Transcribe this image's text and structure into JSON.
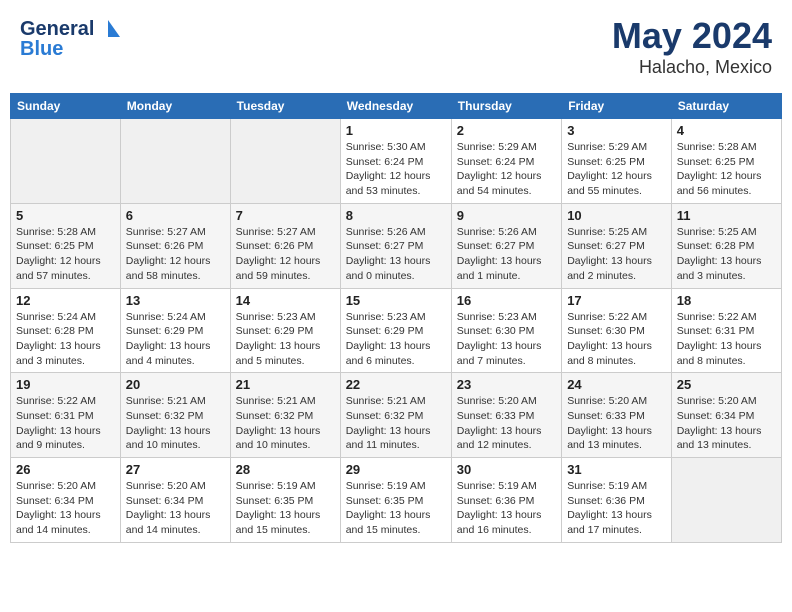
{
  "header": {
    "logo_line1": "General",
    "logo_line2": "Blue",
    "title": "May 2024",
    "location": "Halacho, Mexico"
  },
  "weekdays": [
    "Sunday",
    "Monday",
    "Tuesday",
    "Wednesday",
    "Thursday",
    "Friday",
    "Saturday"
  ],
  "weeks": [
    [
      {
        "day": "",
        "info": ""
      },
      {
        "day": "",
        "info": ""
      },
      {
        "day": "",
        "info": ""
      },
      {
        "day": "1",
        "info": "Sunrise: 5:30 AM\nSunset: 6:24 PM\nDaylight: 12 hours\nand 53 minutes."
      },
      {
        "day": "2",
        "info": "Sunrise: 5:29 AM\nSunset: 6:24 PM\nDaylight: 12 hours\nand 54 minutes."
      },
      {
        "day": "3",
        "info": "Sunrise: 5:29 AM\nSunset: 6:25 PM\nDaylight: 12 hours\nand 55 minutes."
      },
      {
        "day": "4",
        "info": "Sunrise: 5:28 AM\nSunset: 6:25 PM\nDaylight: 12 hours\nand 56 minutes."
      }
    ],
    [
      {
        "day": "5",
        "info": "Sunrise: 5:28 AM\nSunset: 6:25 PM\nDaylight: 12 hours\nand 57 minutes."
      },
      {
        "day": "6",
        "info": "Sunrise: 5:27 AM\nSunset: 6:26 PM\nDaylight: 12 hours\nand 58 minutes."
      },
      {
        "day": "7",
        "info": "Sunrise: 5:27 AM\nSunset: 6:26 PM\nDaylight: 12 hours\nand 59 minutes."
      },
      {
        "day": "8",
        "info": "Sunrise: 5:26 AM\nSunset: 6:27 PM\nDaylight: 13 hours\nand 0 minutes."
      },
      {
        "day": "9",
        "info": "Sunrise: 5:26 AM\nSunset: 6:27 PM\nDaylight: 13 hours\nand 1 minute."
      },
      {
        "day": "10",
        "info": "Sunrise: 5:25 AM\nSunset: 6:27 PM\nDaylight: 13 hours\nand 2 minutes."
      },
      {
        "day": "11",
        "info": "Sunrise: 5:25 AM\nSunset: 6:28 PM\nDaylight: 13 hours\nand 3 minutes."
      }
    ],
    [
      {
        "day": "12",
        "info": "Sunrise: 5:24 AM\nSunset: 6:28 PM\nDaylight: 13 hours\nand 3 minutes."
      },
      {
        "day": "13",
        "info": "Sunrise: 5:24 AM\nSunset: 6:29 PM\nDaylight: 13 hours\nand 4 minutes."
      },
      {
        "day": "14",
        "info": "Sunrise: 5:23 AM\nSunset: 6:29 PM\nDaylight: 13 hours\nand 5 minutes."
      },
      {
        "day": "15",
        "info": "Sunrise: 5:23 AM\nSunset: 6:29 PM\nDaylight: 13 hours\nand 6 minutes."
      },
      {
        "day": "16",
        "info": "Sunrise: 5:23 AM\nSunset: 6:30 PM\nDaylight: 13 hours\nand 7 minutes."
      },
      {
        "day": "17",
        "info": "Sunrise: 5:22 AM\nSunset: 6:30 PM\nDaylight: 13 hours\nand 8 minutes."
      },
      {
        "day": "18",
        "info": "Sunrise: 5:22 AM\nSunset: 6:31 PM\nDaylight: 13 hours\nand 8 minutes."
      }
    ],
    [
      {
        "day": "19",
        "info": "Sunrise: 5:22 AM\nSunset: 6:31 PM\nDaylight: 13 hours\nand 9 minutes."
      },
      {
        "day": "20",
        "info": "Sunrise: 5:21 AM\nSunset: 6:32 PM\nDaylight: 13 hours\nand 10 minutes."
      },
      {
        "day": "21",
        "info": "Sunrise: 5:21 AM\nSunset: 6:32 PM\nDaylight: 13 hours\nand 10 minutes."
      },
      {
        "day": "22",
        "info": "Sunrise: 5:21 AM\nSunset: 6:32 PM\nDaylight: 13 hours\nand 11 minutes."
      },
      {
        "day": "23",
        "info": "Sunrise: 5:20 AM\nSunset: 6:33 PM\nDaylight: 13 hours\nand 12 minutes."
      },
      {
        "day": "24",
        "info": "Sunrise: 5:20 AM\nSunset: 6:33 PM\nDaylight: 13 hours\nand 13 minutes."
      },
      {
        "day": "25",
        "info": "Sunrise: 5:20 AM\nSunset: 6:34 PM\nDaylight: 13 hours\nand 13 minutes."
      }
    ],
    [
      {
        "day": "26",
        "info": "Sunrise: 5:20 AM\nSunset: 6:34 PM\nDaylight: 13 hours\nand 14 minutes."
      },
      {
        "day": "27",
        "info": "Sunrise: 5:20 AM\nSunset: 6:34 PM\nDaylight: 13 hours\nand 14 minutes."
      },
      {
        "day": "28",
        "info": "Sunrise: 5:19 AM\nSunset: 6:35 PM\nDaylight: 13 hours\nand 15 minutes."
      },
      {
        "day": "29",
        "info": "Sunrise: 5:19 AM\nSunset: 6:35 PM\nDaylight: 13 hours\nand 15 minutes."
      },
      {
        "day": "30",
        "info": "Sunrise: 5:19 AM\nSunset: 6:36 PM\nDaylight: 13 hours\nand 16 minutes."
      },
      {
        "day": "31",
        "info": "Sunrise: 5:19 AM\nSunset: 6:36 PM\nDaylight: 13 hours\nand 17 minutes."
      },
      {
        "day": "",
        "info": ""
      }
    ]
  ]
}
